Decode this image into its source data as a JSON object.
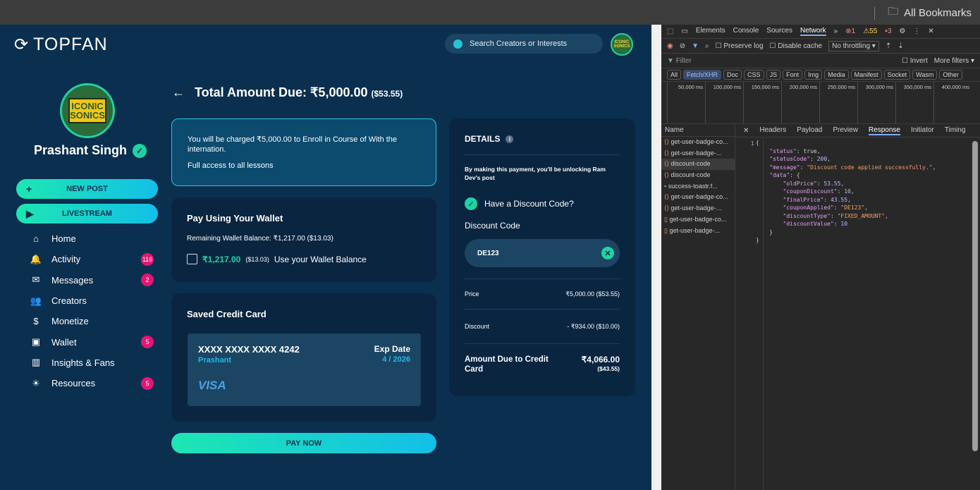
{
  "browser": {
    "bookmarks_label": "All Bookmarks"
  },
  "header": {
    "logo_text": "TOPFAN",
    "search_placeholder": "Search Creators or Interests",
    "avatar_text": "ICONIC SONICS"
  },
  "profile": {
    "avatar_text": "ICONIC SONICS",
    "name": "Prashant Singh"
  },
  "buttons": {
    "new_post": "NEW POST",
    "livestream": "LIVESTREAM",
    "pay_now": "PAY NOW"
  },
  "nav": [
    {
      "label": "Home",
      "icon": "home-icon",
      "glyph": "⌂",
      "badge": ""
    },
    {
      "label": "Activity",
      "icon": "bell-icon",
      "glyph": "🔔",
      "badge": "116"
    },
    {
      "label": "Messages",
      "icon": "message-icon",
      "glyph": "✉",
      "badge": "2"
    },
    {
      "label": "Creators",
      "icon": "users-icon",
      "glyph": "👥",
      "badge": ""
    },
    {
      "label": "Monetize",
      "icon": "dollar-icon",
      "glyph": "$",
      "badge": ""
    },
    {
      "label": "Wallet",
      "icon": "wallet-icon",
      "glyph": "▣",
      "badge": "5"
    },
    {
      "label": "Insights & Fans",
      "icon": "chart-icon",
      "glyph": "▥",
      "badge": ""
    },
    {
      "label": "Resources",
      "icon": "lightbulb-icon",
      "glyph": "☀",
      "badge": "5"
    }
  ],
  "payment": {
    "title": "Total Amount Due: ₹5,000.00",
    "title_usd": "($53.55)",
    "info_line1": "You will be charged ₹5,000.00 to Enroll in Course of With the internation.",
    "info_line2": "Full access to all lessons",
    "wallet_heading": "Pay Using Your Wallet",
    "wallet_balance": "Remaining Wallet Balance: ₹1,217.00 ($13.03)",
    "wallet_amount": "₹1,217.00",
    "wallet_usd": "($13.03)",
    "wallet_use": "Use your Wallet Balance",
    "card_heading": "Saved Credit Card",
    "card_number": "XXXX XXXX XXXX 4242",
    "card_name": "Prashant",
    "exp_label": "Exp Date",
    "exp_value": "4 / 2026",
    "card_brand": "VISA"
  },
  "details": {
    "heading": "DETAILS",
    "unlock_text": "By making this payment, you'll be unlocking Ram Dev's post",
    "discount_question": "Have a Discount Code?",
    "discount_label": "Discount Code",
    "discount_value": "DE123",
    "price_label": "Price",
    "price_value": "₹5,000.00 ($53.55)",
    "discount_row_label": "Discount",
    "discount_row_value": "- ₹934.00 ($10.00)",
    "due_label": "Amount Due to Credit Card",
    "due_value": "₹4,066.00",
    "due_usd": "($43.55)"
  },
  "devtools": {
    "tabs": [
      "Elements",
      "Console",
      "Sources",
      "Network"
    ],
    "counts": {
      "errors": "1",
      "warnings": "55",
      "issues": "3"
    },
    "preserve_log": "Preserve log",
    "disable_cache": "Disable cache",
    "throttling": "No throttling",
    "filter_placeholder": "Filter",
    "invert": "Invert",
    "more_filters": "More filters",
    "types": [
      "All",
      "Fetch/XHR",
      "Doc",
      "CSS",
      "JS",
      "Font",
      "Img",
      "Media",
      "Manifest",
      "Socket",
      "Wasm",
      "Other"
    ],
    "timeline": [
      "50,000 ms",
      "100,000 ms",
      "150,000 ms",
      "200,000 ms",
      "250,000 ms",
      "300,000 ms",
      "350,000 ms",
      "400,000 ms"
    ],
    "name_header": "Name",
    "requests": [
      "get-user-badge-co...",
      "get-user-badge-...",
      "discount-code",
      "discount-code",
      "success-toastr.f...",
      "get-user-badge-co...",
      "get-user-badge-...",
      "get-user-badge-co...",
      "get-user-badge-..."
    ],
    "detail_tabs": [
      "Headers",
      "Payload",
      "Preview",
      "Response",
      "Initiator",
      "Timing"
    ],
    "line_number": "1"
  }
}
